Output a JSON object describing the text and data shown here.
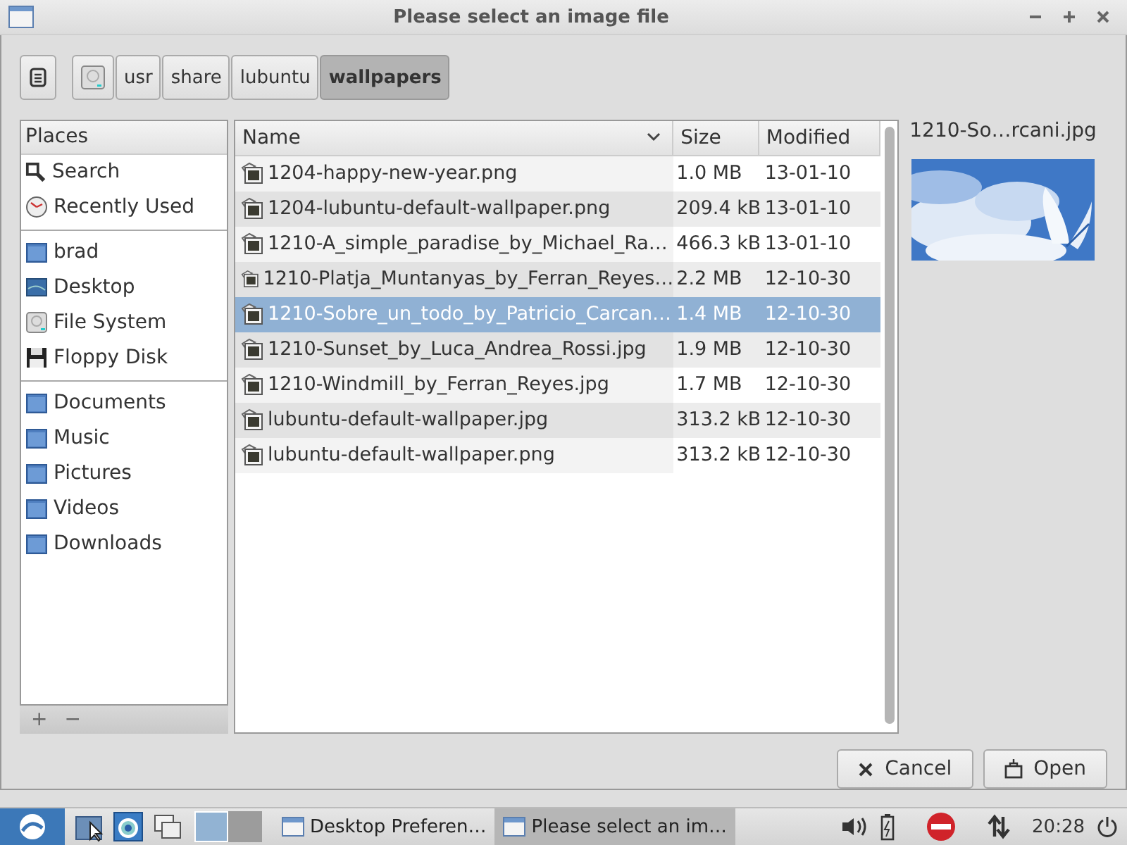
{
  "window": {
    "title": "Please select an image file"
  },
  "path_bar": [
    {
      "kind": "disk",
      "selected": false
    },
    {
      "label": "usr",
      "kind": "folder",
      "selected": false
    },
    {
      "label": "share",
      "kind": "folder",
      "selected": false
    },
    {
      "label": "lubuntu",
      "kind": "folder",
      "selected": false
    },
    {
      "label": "wallpapers",
      "kind": "folder",
      "selected": true
    }
  ],
  "places": {
    "heading": "Places",
    "groups": [
      [
        {
          "label": "Search",
          "kind": "search"
        },
        {
          "label": "Recently Used",
          "kind": "recent"
        }
      ],
      [
        {
          "label": "brad",
          "kind": "folder"
        },
        {
          "label": "Desktop",
          "kind": "desktop"
        },
        {
          "label": "File System",
          "kind": "disk"
        },
        {
          "label": "Floppy Disk",
          "kind": "floppy"
        }
      ],
      [
        {
          "label": "Documents",
          "kind": "folder"
        },
        {
          "label": "Music",
          "kind": "folder"
        },
        {
          "label": "Pictures",
          "kind": "folder"
        },
        {
          "label": "Videos",
          "kind": "folder"
        },
        {
          "label": "Downloads",
          "kind": "folder"
        }
      ]
    ],
    "add": "+",
    "remove": "−"
  },
  "table": {
    "columns": [
      "Name",
      "Size",
      "Modified"
    ],
    "rows": [
      {
        "name": "1204-happy-new-year.png",
        "size": "1.0 MB",
        "modified": "13-01-10",
        "selected": false
      },
      {
        "name": "1204-lubuntu-default-wallpaper.png",
        "size": "209.4 kB",
        "modified": "13-01-10",
        "selected": false
      },
      {
        "name": "1210-A_simple_paradise_by_Michael_Ra…",
        "size": "466.3 kB",
        "modified": "13-01-10",
        "selected": false
      },
      {
        "name": "1210-Platja_Muntanyas_by_Ferran_Reyes…",
        "size": "2.2 MB",
        "modified": "12-10-30",
        "selected": false
      },
      {
        "name": "1210-Sobre_un_todo_by_Patricio_Carcan…",
        "size": "1.4 MB",
        "modified": "12-10-30",
        "selected": true
      },
      {
        "name": "1210-Sunset_by_Luca_Andrea_Rossi.jpg",
        "size": "1.9 MB",
        "modified": "12-10-30",
        "selected": false
      },
      {
        "name": "1210-Windmill_by_Ferran_Reyes.jpg",
        "size": "1.7 MB",
        "modified": "12-10-30",
        "selected": false
      },
      {
        "name": "lubuntu-default-wallpaper.jpg",
        "size": "313.2 kB",
        "modified": "12-10-30",
        "selected": false
      },
      {
        "name": "lubuntu-default-wallpaper.png",
        "size": "313.2 kB",
        "modified": "12-10-30",
        "selected": false
      }
    ]
  },
  "preview": {
    "filename": "1210-So…rcani.jpg",
    "kind": "picture"
  },
  "buttons": [
    {
      "label": "Cancel",
      "kind": "cancel"
    },
    {
      "label": "Open",
      "kind": "open"
    }
  ],
  "taskbar": {
    "pager": [
      {
        "selected": true
      },
      {
        "selected": false
      }
    ],
    "tasks": [
      {
        "label": "Desktop Preferen…",
        "selected": false
      },
      {
        "label": "Please select an im…",
        "selected": true
      }
    ],
    "clock": "20:28"
  }
}
